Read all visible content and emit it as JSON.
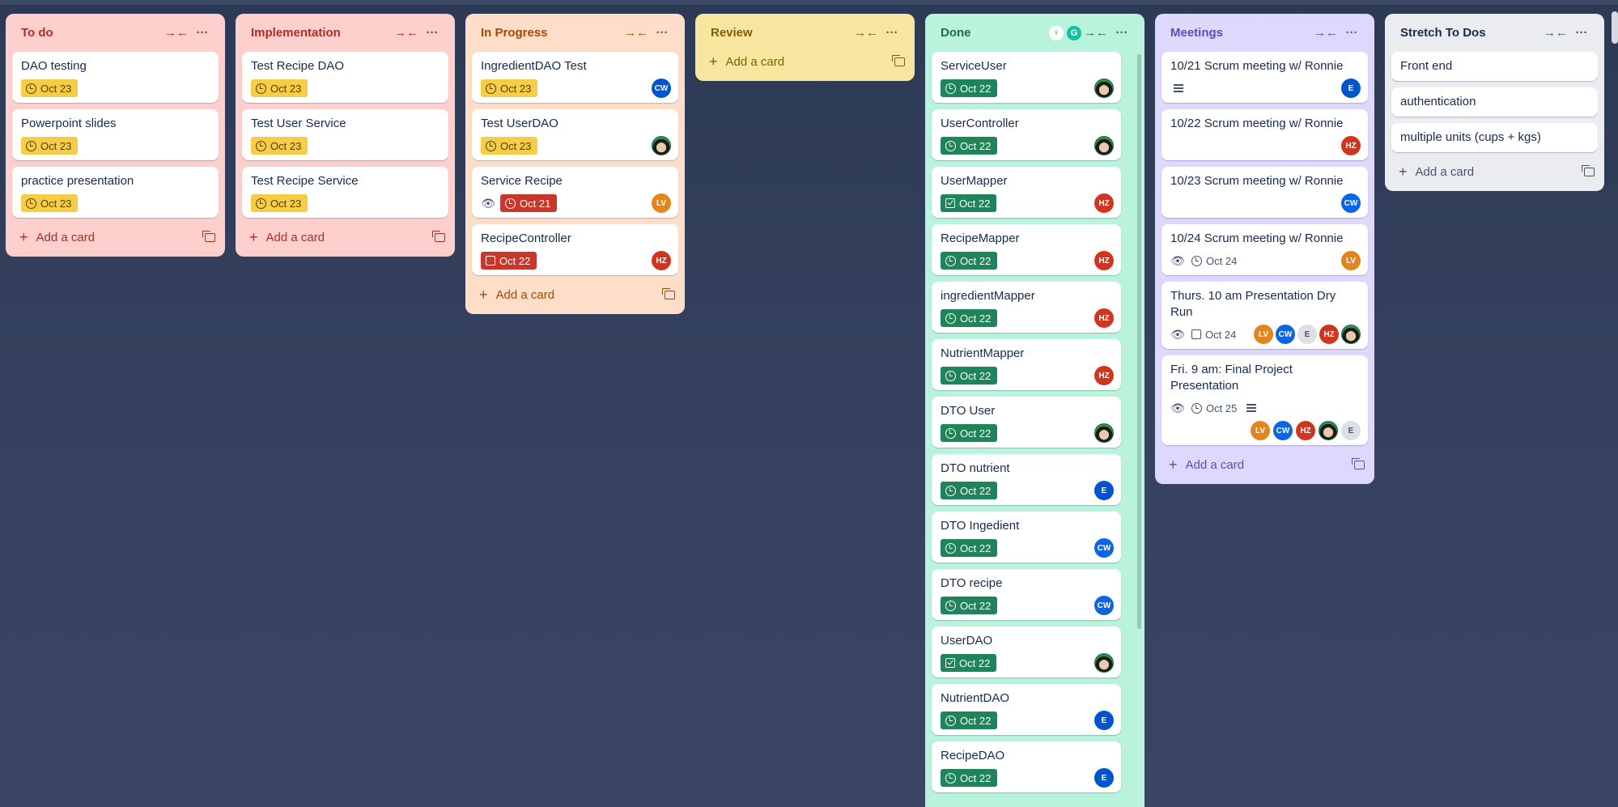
{
  "colors": {
    "todo_bg": "#fdd0cd",
    "todo_text": "#ae2e24",
    "impl_bg": "#fdd0cd",
    "impl_text": "#ae2e24",
    "inprog_bg": "#fedec8",
    "inprog_text": "#a54800",
    "review_bg": "#f8e6a0",
    "review_text": "#7f5f01",
    "done_bg": "#baf3db",
    "done_text": "#216e4e",
    "meet_bg": "#dfd8fd",
    "meet_text": "#5e4db2",
    "stretch_bg": "#ebecf0",
    "stretch_text": "#172b4d"
  },
  "common": {
    "collapse": "→←",
    "more": "···",
    "add_card": "Add a card",
    "plus": "+"
  },
  "lists": {
    "todo": {
      "title": "To do",
      "cards": [
        {
          "title": "DAO testing",
          "due": "Oct 23"
        },
        {
          "title": "Powerpoint slides",
          "due": "Oct 23"
        },
        {
          "title": "practice presentation",
          "due": "Oct 23"
        }
      ]
    },
    "impl": {
      "title": "Implementation",
      "cards": [
        {
          "title": "Test Recipe DAO",
          "due": "Oct 23"
        },
        {
          "title": "Test User Service",
          "due": "Oct 23"
        },
        {
          "title": "Test Recipe Service",
          "due": "Oct 23"
        }
      ]
    },
    "inprog": {
      "title": "In Progress",
      "cards": [
        {
          "title": "IngredientDAO Test",
          "due": "Oct 23",
          "member": "CW"
        },
        {
          "title": "Test UserDAO",
          "due": "Oct 23"
        },
        {
          "title": "Service Recipe",
          "due": "Oct 21",
          "member": "LV"
        },
        {
          "title": "RecipeController",
          "due": "Oct 22",
          "member": "HZ"
        }
      ]
    },
    "review": {
      "title": "Review"
    },
    "done": {
      "title": "Done",
      "cards": [
        {
          "title": "ServiceUser",
          "due": "Oct 22"
        },
        {
          "title": "UserController",
          "due": "Oct 22"
        },
        {
          "title": "UserMapper",
          "due": "Oct 22",
          "member": "HZ"
        },
        {
          "title": "RecipeMapper",
          "due": "Oct 22",
          "member": "HZ"
        },
        {
          "title": "ingredientMapper",
          "due": "Oct 22",
          "member": "HZ"
        },
        {
          "title": "NutrientMapper",
          "due": "Oct 22",
          "member": "HZ"
        },
        {
          "title": "DTO User",
          "due": "Oct 22"
        },
        {
          "title": "DTO nutrient",
          "due": "Oct 22",
          "member": "E"
        },
        {
          "title": "DTO Ingedient",
          "due": "Oct 22",
          "member": "CW"
        },
        {
          "title": "DTO recipe",
          "due": "Oct 22",
          "member": "CW"
        },
        {
          "title": "UserDAO",
          "due": "Oct 22"
        },
        {
          "title": "NutrientDAO",
          "due": "Oct 22",
          "member": "E"
        },
        {
          "title": "RecipeDAO",
          "due": "Oct 22",
          "member": "E"
        }
      ]
    },
    "meet": {
      "title": "Meetings",
      "cards": [
        {
          "title": "10/21 Scrum meeting w/ Ronnie",
          "member": "E"
        },
        {
          "title": "10/22 Scrum meeting w/ Ronnie",
          "member": "HZ"
        },
        {
          "title": "10/23 Scrum meeting w/ Ronnie",
          "member": "CW"
        },
        {
          "title": "10/24 Scrum meeting w/ Ronnie",
          "due": "Oct 24",
          "member": "LV"
        },
        {
          "title": "Thurs. 10 am Presentation Dry Run",
          "due": "Oct 24",
          "members": [
            "LV",
            "CW",
            "E",
            "HZ"
          ]
        },
        {
          "title": "Fri. 9 am: Final Project Presentation",
          "due": "Oct 25",
          "members": [
            "LV",
            "CW",
            "HZ",
            "E"
          ]
        }
      ]
    },
    "stretch": {
      "title": "Stretch To Dos",
      "cards": [
        {
          "title": "Front end"
        },
        {
          "title": "authentication"
        },
        {
          "title": "multiple units (cups + kgs)"
        }
      ]
    }
  }
}
